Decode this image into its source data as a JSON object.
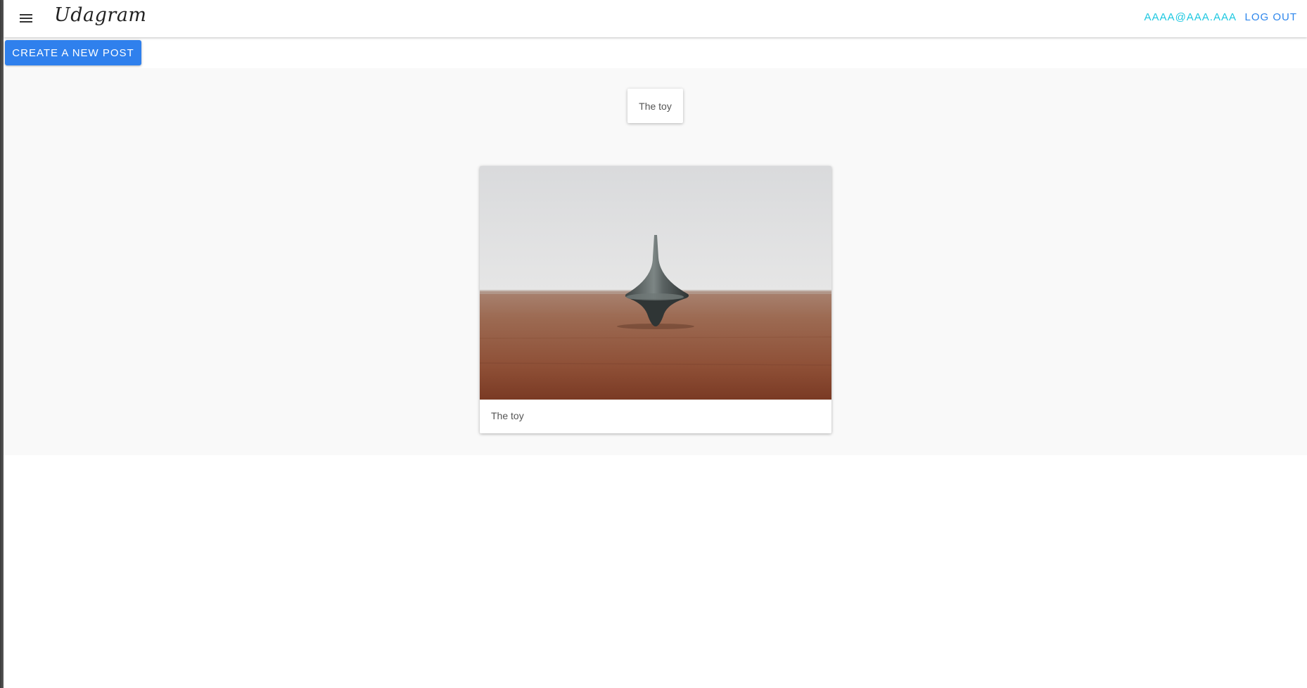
{
  "header": {
    "brand": "Udagram",
    "user_email": "AAAA@AAA.AAA",
    "logout_label": "LOG OUT"
  },
  "toolbar": {
    "create_post_label": "CREATE A NEW POST"
  },
  "feed": {
    "filter_tag": "The toy",
    "posts": [
      {
        "caption": "The toy",
        "image_icon": "spinning-top-photo"
      }
    ]
  },
  "colors": {
    "primary": "#2f80ed",
    "user_link": "#1bc7e0",
    "logout_link": "#2d86ec",
    "feed_background": "#f9f9f9"
  }
}
